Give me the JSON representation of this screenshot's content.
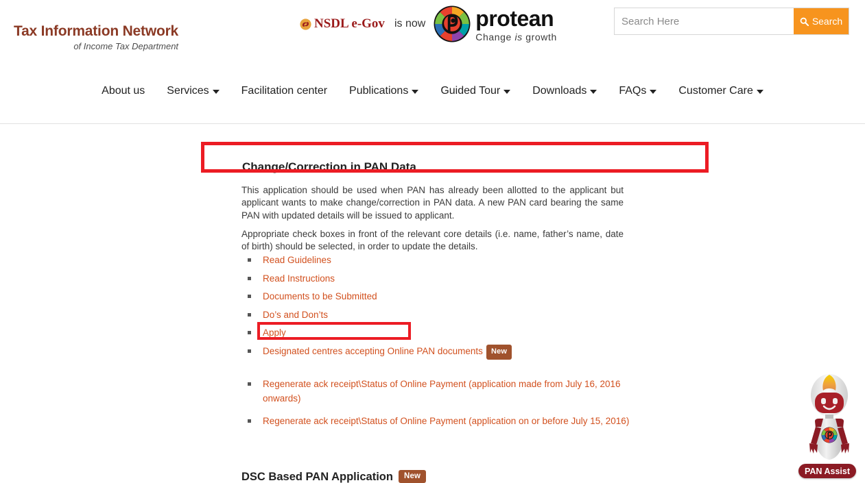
{
  "header": {
    "brand_title": "Tax Information Network",
    "brand_subtitle": "of Income Tax Department",
    "nsdl_label": "NSDL e-Gov",
    "is_now_text": "is now",
    "protean_name": "protean",
    "protean_tagline_pre": "Change ",
    "protean_tagline_em": "is",
    "protean_tagline_post": " growth",
    "nsdl_icon": "nsdl-swirl-icon",
    "protean_icon": "protean-mandala-icon"
  },
  "search": {
    "placeholder": "Search Here",
    "value": "",
    "button_label": "Search",
    "icon": "search-icon",
    "button_color": "#f7941e"
  },
  "nav": {
    "items": [
      {
        "label": "About us",
        "has_dropdown": false
      },
      {
        "label": "Services",
        "has_dropdown": true
      },
      {
        "label": "Facilitation center",
        "has_dropdown": false
      },
      {
        "label": "Publications",
        "has_dropdown": true
      },
      {
        "label": "Guided Tour",
        "has_dropdown": true
      },
      {
        "label": "Downloads",
        "has_dropdown": true
      },
      {
        "label": "FAQs",
        "has_dropdown": true
      },
      {
        "label": "Customer Care",
        "has_dropdown": true
      }
    ]
  },
  "main": {
    "section_title": "Change/Correction in PAN Data",
    "paragraph_1": "This application should be used when PAN has already been allotted to the applicant but applicant wants to make change/correction in PAN data. A new PAN card bearing the same PAN with updated details will be issued to applicant.",
    "paragraph_2": "Appropriate check boxes in front of the relevant core details (i.e. name, father’s name, date of birth) should be selected, in order to update the details.",
    "links": [
      {
        "label": "Read Guidelines",
        "badge": ""
      },
      {
        "label": "Read Instructions",
        "badge": ""
      },
      {
        "label": "Documents to be Submitted",
        "badge": ""
      },
      {
        "label": "Do’s and Don’ts",
        "badge": ""
      },
      {
        "label": "Apply",
        "badge": ""
      },
      {
        "label": "Designated centres accepting Online PAN documents",
        "badge": "New"
      }
    ],
    "secondary_links": [
      {
        "label": "Regenerate ack receipt\\Status of Online Payment (application made from July 16, 2016 onwards)"
      },
      {
        "label": "Regenerate ack receipt\\Status of Online Payment (application on or before July 15, 2016)"
      }
    ],
    "dsc_heading": "DSC Based PAN Application",
    "dsc_badge": "New",
    "link_color": "#d2501e",
    "badge_color": "#a0522d"
  },
  "annotations": {
    "highlight_color": "#ec1c24",
    "boxes": [
      {
        "target": "section-title",
        "label": "Change/Correction in PAN Data"
      },
      {
        "target": "apply-link",
        "label": "Apply"
      }
    ]
  },
  "mascot": {
    "label": "PAN Assist",
    "icon": "robot-assistant-icon",
    "label_color": "#8b1b24"
  }
}
